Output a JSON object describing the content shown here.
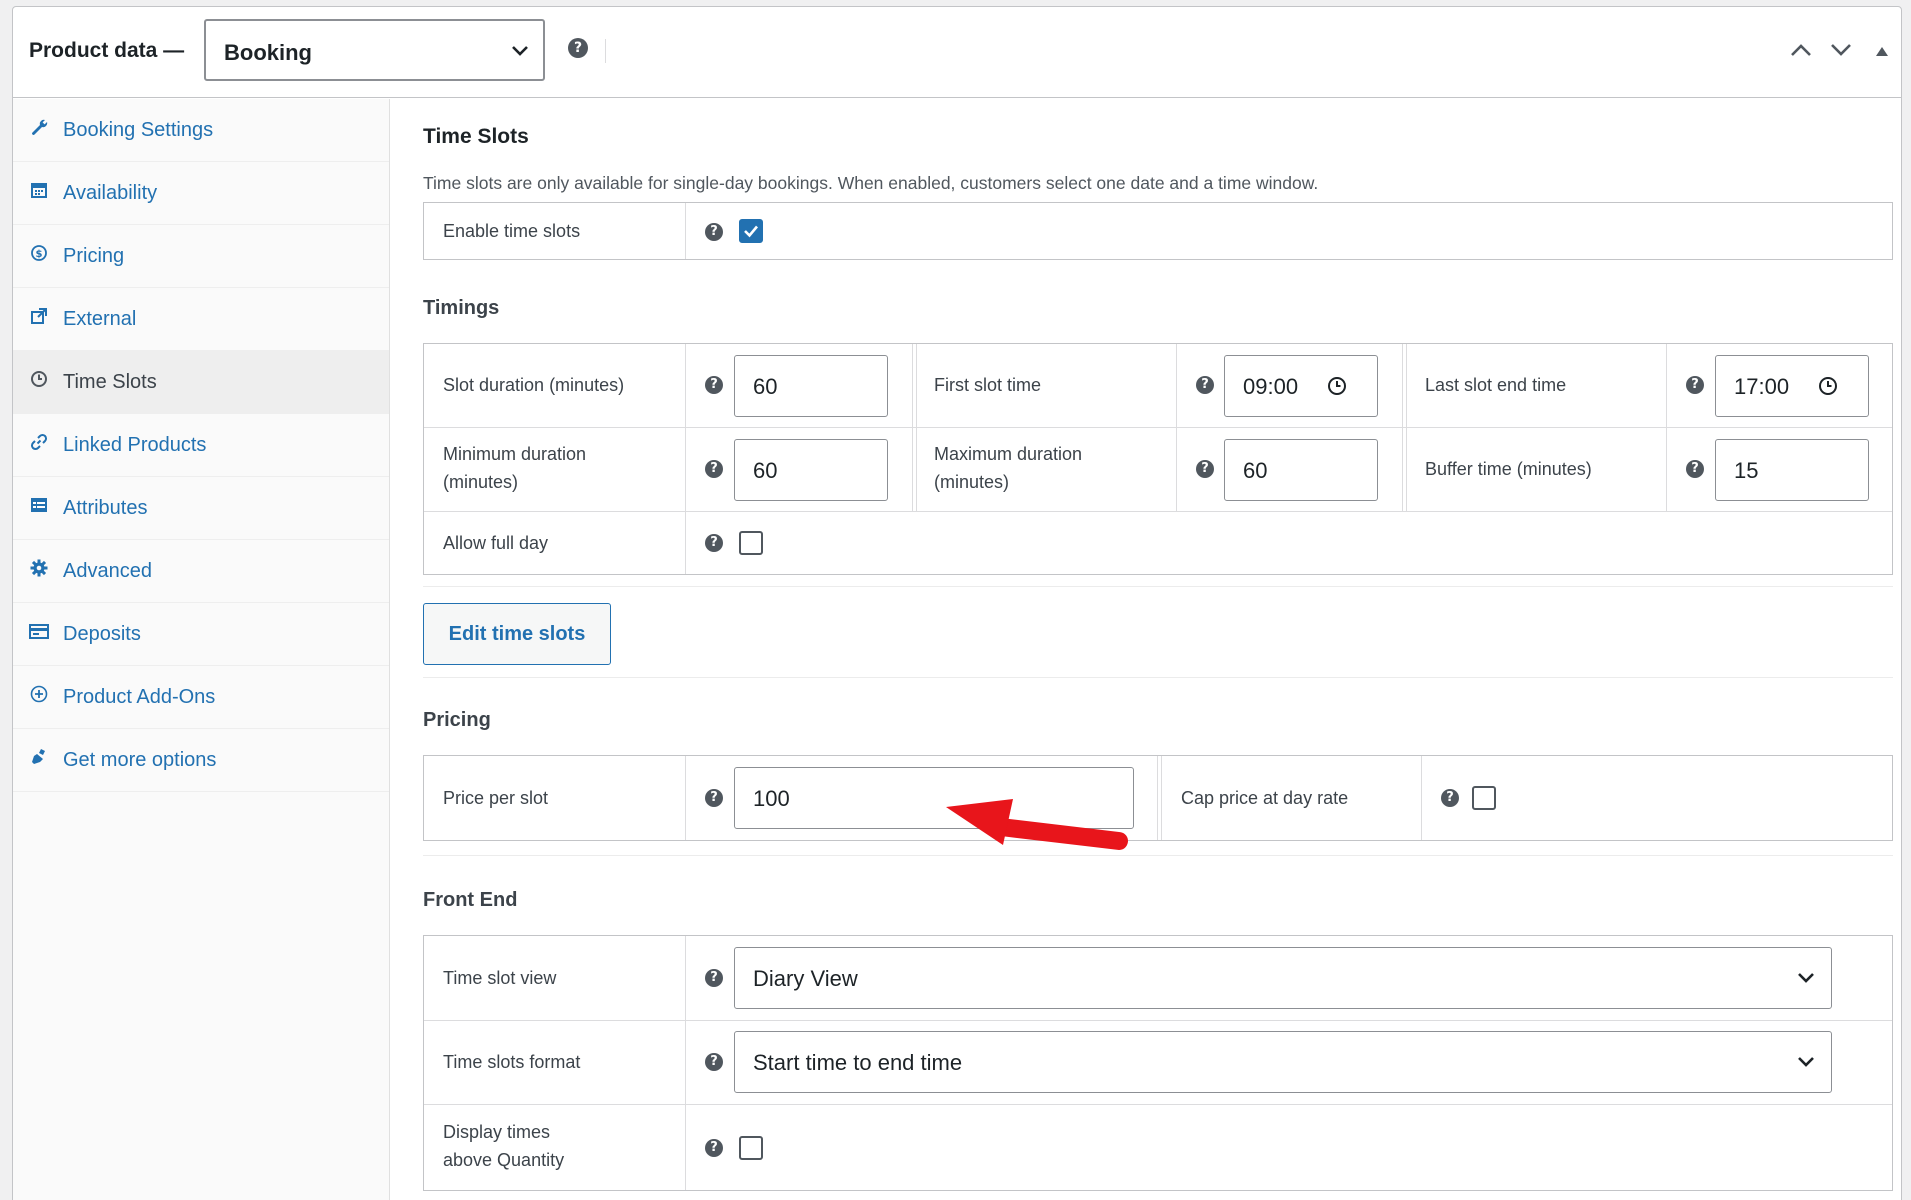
{
  "header": {
    "label": "Product data —",
    "product_type": "Booking"
  },
  "sidebar": {
    "items": [
      {
        "label": "Booking Settings",
        "icon": "wrench-icon"
      },
      {
        "label": "Availability",
        "icon": "calendar-icon"
      },
      {
        "label": "Pricing",
        "icon": "dollar-icon"
      },
      {
        "label": "External",
        "icon": "external-link-icon"
      },
      {
        "label": "Time Slots",
        "icon": "clock-icon",
        "active": true
      },
      {
        "label": "Linked Products",
        "icon": "link-icon"
      },
      {
        "label": "Attributes",
        "icon": "list-icon"
      },
      {
        "label": "Advanced",
        "icon": "gear-icon"
      },
      {
        "label": "Deposits",
        "icon": "card-icon"
      },
      {
        "label": "Product Add-Ons",
        "icon": "plus-circle-icon"
      },
      {
        "label": "Get more options",
        "icon": "plugin-icon"
      }
    ]
  },
  "time_slots": {
    "title": "Time Slots",
    "description": "Time slots are only available for single-day bookings. When enabled, customers select one date and a time window.",
    "enable_label": "Enable time slots",
    "enable_checked": true
  },
  "timings": {
    "title": "Timings",
    "slot_duration_label": "Slot duration (minutes)",
    "slot_duration_value": "60",
    "first_slot_label": "First slot time",
    "first_slot_value": "09:00",
    "last_slot_label": "Last slot end time",
    "last_slot_value": "17:00",
    "min_duration_label_1": "Minimum duration",
    "min_duration_label_2": "(minutes)",
    "min_duration_value": "60",
    "max_duration_label_1": "Maximum duration",
    "max_duration_label_2": "(minutes)",
    "max_duration_value": "60",
    "buffer_label": "Buffer time (minutes)",
    "buffer_value": "15",
    "full_day_label": "Allow full day",
    "full_day_checked": false
  },
  "edit_button": "Edit time slots",
  "pricing": {
    "title": "Pricing",
    "price_label": "Price per slot",
    "price_value": "100",
    "cap_label": "Cap price at day rate",
    "cap_checked": false
  },
  "front_end": {
    "title": "Front End",
    "view_label": "Time slot view",
    "view_value": "Diary View",
    "format_label": "Time slots format",
    "format_value": "Start time to end time",
    "display_label_1": "Display times",
    "display_label_2": "above Quantity",
    "display_checked": false
  },
  "colors": {
    "accent": "#2271b1",
    "arrow": "#e8151b"
  }
}
